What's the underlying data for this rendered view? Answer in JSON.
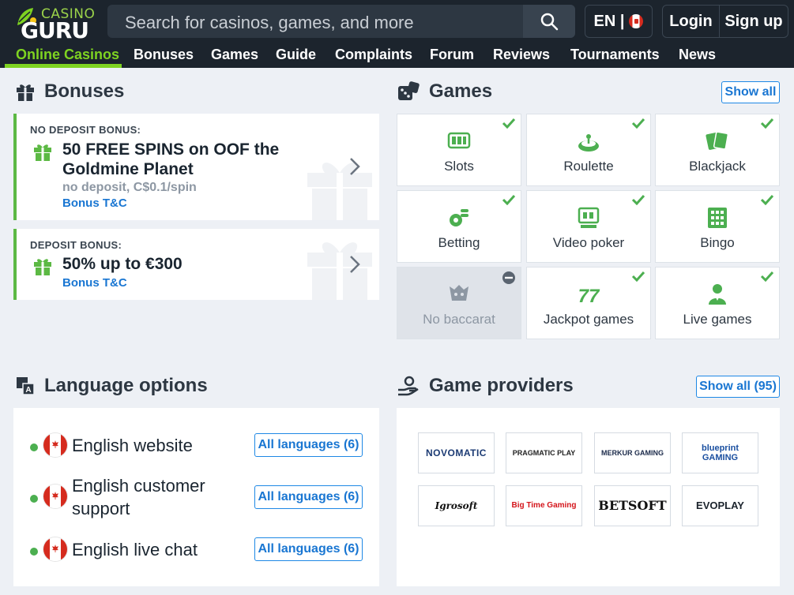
{
  "header": {
    "logo_top": "CASINO",
    "logo_bottom": "GURU",
    "search_placeholder": "Search for casinos, games, and more",
    "language": "EN |",
    "login": "Login",
    "signup": "Sign up",
    "nav": [
      "Online Casinos",
      "Bonuses",
      "Games",
      "Guide",
      "Complaints",
      "Forum",
      "Reviews",
      "Tournaments",
      "News"
    ]
  },
  "bonuses": {
    "title": "Bonuses",
    "cards": [
      {
        "kind": "NO DEPOSIT BONUS:",
        "title": "50 FREE SPINS on OOF the Goldmine Planet",
        "sub": "no deposit, C$0.1/spin",
        "tc": "Bonus T&C"
      },
      {
        "kind": "DEPOSIT BONUS:",
        "title": "50% up to €300",
        "tc": "Bonus T&C"
      }
    ]
  },
  "games": {
    "title": "Games",
    "show_all": "Show all",
    "items": [
      {
        "label": "Slots",
        "icon": "slot-machine-icon",
        "available": true
      },
      {
        "label": "Roulette",
        "icon": "roulette-icon",
        "available": true
      },
      {
        "label": "Blackjack",
        "icon": "cards-icon",
        "available": true
      },
      {
        "label": "Betting",
        "icon": "betting-icon",
        "available": true
      },
      {
        "label": "Video poker",
        "icon": "video-poker-icon",
        "available": true
      },
      {
        "label": "Bingo",
        "icon": "bingo-icon",
        "available": true
      },
      {
        "label": "No baccarat",
        "icon": "baccarat-icon",
        "available": false
      },
      {
        "label": "Jackpot games",
        "icon": "jackpot-icon",
        "available": true
      },
      {
        "label": "Live games",
        "icon": "live-dealer-icon",
        "available": true
      }
    ]
  },
  "languages": {
    "title": "Language options",
    "rows": [
      {
        "label": "English website",
        "button": "All languages (6)"
      },
      {
        "label": "English customer support",
        "button": "All languages (6)"
      },
      {
        "label": "English live chat",
        "button": "All languages (6)"
      }
    ]
  },
  "providers": {
    "title": "Game providers",
    "show_all": "Show all (95)",
    "items": [
      "NOVOMATIC",
      "PRAGMATIC PLAY",
      "MERKUR GAMING",
      "blueprint GAMING",
      "Igrosoft",
      "Big Time Gaming",
      "BETSOFT",
      "EVOPLAY"
    ]
  },
  "colors": {
    "green": "#5cb944",
    "blue": "#1976d2",
    "header": "#1c242d"
  }
}
